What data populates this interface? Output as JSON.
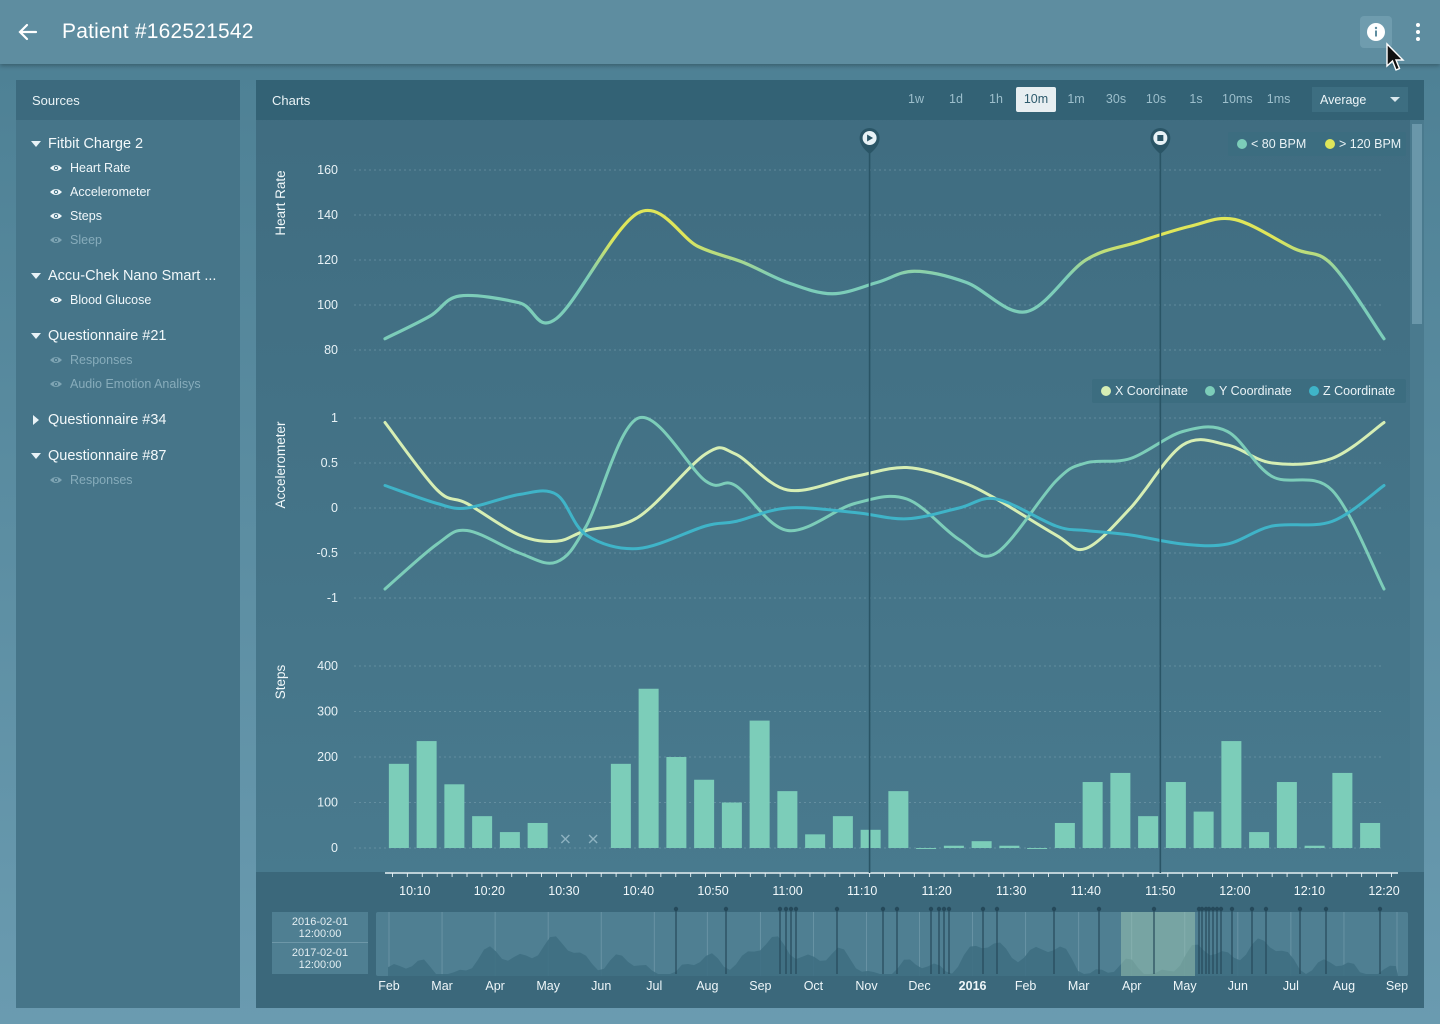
{
  "appbar": {
    "title": "Patient #162521542",
    "back_icon": "arrow-left-icon",
    "info_icon": "info-icon",
    "more_icon": "more-vert-icon"
  },
  "sources": {
    "title": "Sources",
    "groups": [
      {
        "title": "Fitbit Charge 2",
        "expanded": true,
        "items": [
          {
            "label": "Heart Rate",
            "visible": true
          },
          {
            "label": "Accelerometer",
            "visible": true
          },
          {
            "label": "Steps",
            "visible": true
          },
          {
            "label": "Sleep",
            "visible": false
          }
        ]
      },
      {
        "title": "Accu-Chek Nano Smart ...",
        "expanded": true,
        "items": [
          {
            "label": "Blood Glucose",
            "visible": true
          }
        ]
      },
      {
        "title": "Questionnaire #21",
        "expanded": true,
        "items": [
          {
            "label": "Responses",
            "visible": false
          },
          {
            "label": "Audio Emotion Analisys",
            "visible": false
          }
        ]
      },
      {
        "title": "Questionnaire #34",
        "expanded": false,
        "items": []
      },
      {
        "title": "Questionnaire #87",
        "expanded": true,
        "items": [
          {
            "label": "Responses",
            "visible": false
          }
        ]
      }
    ]
  },
  "charts": {
    "title": "Charts",
    "ranges": [
      "1w",
      "1d",
      "1h",
      "10m",
      "1m",
      "30s",
      "10s",
      "1s",
      "10ms",
      "1ms"
    ],
    "active_range": "10m",
    "aggregation": "Average",
    "colors": {
      "low": "#7ccdb9",
      "high": "#dfe65a",
      "x": "#d6eeb4",
      "y": "#7ccdb9",
      "z": "#3fb4c8"
    }
  },
  "chart_data": [
    {
      "type": "line",
      "ylabel": "Heart Rate",
      "ylim": [
        80,
        160
      ],
      "yticks": [
        160,
        140,
        120,
        100,
        80
      ],
      "legend": [
        "< 80 BPM",
        "> 120 BPM"
      ],
      "x": [
        "10:06",
        "10:12",
        "10:16",
        "10:24",
        "10:29",
        "10:40",
        "10:48",
        "10:54",
        "11:00",
        "11:06",
        "11:12",
        "11:17",
        "11:24",
        "11:32",
        "11:40",
        "11:47",
        "11:54",
        "12:00",
        "12:08",
        "12:13",
        "12:20"
      ],
      "series": [
        {
          "values": [
            85,
            95,
            104,
            101,
            94,
            141,
            126,
            119,
            110,
            105,
            110,
            115,
            110,
            97,
            120,
            128,
            135,
            138,
            125,
            118,
            85
          ]
        }
      ]
    },
    {
      "type": "line",
      "ylabel": "Accelerometer",
      "ylim": [
        -1,
        1
      ],
      "yticks": [
        "1",
        "0.5",
        "0",
        "-0.5",
        "-1"
      ],
      "legend": [
        "X Coordinate",
        "Y Coordinate",
        "Z Coordinate"
      ],
      "x": [
        "10:06",
        "10:13",
        "10:17",
        "10:24",
        "10:29",
        "10:33",
        "10:40",
        "10:49",
        "10:53",
        "11:00",
        "11:09",
        "11:16",
        "11:23",
        "11:28",
        "11:36",
        "11:40",
        "11:46",
        "11:53",
        "11:59",
        "12:05",
        "12:13",
        "12:20"
      ],
      "series": [
        {
          "name": "X Coordinate",
          "values": [
            0.95,
            0.2,
            0.05,
            -0.3,
            -0.37,
            -0.25,
            -0.1,
            0.6,
            0.6,
            0.2,
            0.35,
            0.45,
            0.3,
            0.1,
            -0.3,
            -0.45,
            0.0,
            0.7,
            0.7,
            0.5,
            0.55,
            0.95
          ]
        },
        {
          "name": "Y Coordinate",
          "values": [
            -0.9,
            -0.4,
            -0.25,
            -0.5,
            -0.6,
            -0.2,
            1.0,
            0.3,
            0.25,
            -0.25,
            0.05,
            0.1,
            -0.35,
            -0.5,
            0.3,
            0.5,
            0.55,
            0.85,
            0.85,
            0.35,
            0.2,
            -0.9
          ]
        },
        {
          "name": "Z Coordinate",
          "values": [
            0.25,
            0.05,
            0.0,
            0.15,
            0.15,
            -0.3,
            -0.45,
            -0.2,
            -0.15,
            0.0,
            -0.05,
            -0.12,
            0.0,
            0.1,
            -0.2,
            -0.25,
            -0.3,
            -0.4,
            -0.4,
            -0.2,
            -0.15,
            0.25
          ]
        }
      ]
    },
    {
      "type": "bar",
      "ylabel": "Steps",
      "ylim": [
        0,
        400
      ],
      "yticks": [
        400,
        300,
        200,
        100,
        0
      ],
      "values": [
        185,
        235,
        140,
        70,
        35,
        55,
        null,
        null,
        185,
        350,
        200,
        150,
        100,
        280,
        125,
        30,
        70,
        40,
        125,
        0,
        5,
        15,
        5,
        0,
        55,
        145,
        165,
        70,
        145,
        80,
        235,
        35,
        145,
        5,
        165,
        55
      ]
    }
  ],
  "xaxis": {
    "ticks": [
      "10:10",
      "10:20",
      "10:30",
      "10:40",
      "10:50",
      "11:00",
      "11:10",
      "11:20",
      "11:30",
      "11:40",
      "11:50",
      "12:00",
      "12:10",
      "12:20"
    ]
  },
  "overview": {
    "start_date": "2016-02-01",
    "start_time": "12:00:00",
    "end_date": "2017-02-01",
    "end_time": "12:00:00",
    "months": [
      "Feb",
      "Mar",
      "Apr",
      "May",
      "Jun",
      "Jul",
      "Aug",
      "Sep",
      "Oct",
      "Nov",
      "Dec",
      "2016",
      "Feb",
      "Mar",
      "Apr",
      "May",
      "Jun",
      "Jul",
      "Aug",
      "Sep"
    ]
  }
}
